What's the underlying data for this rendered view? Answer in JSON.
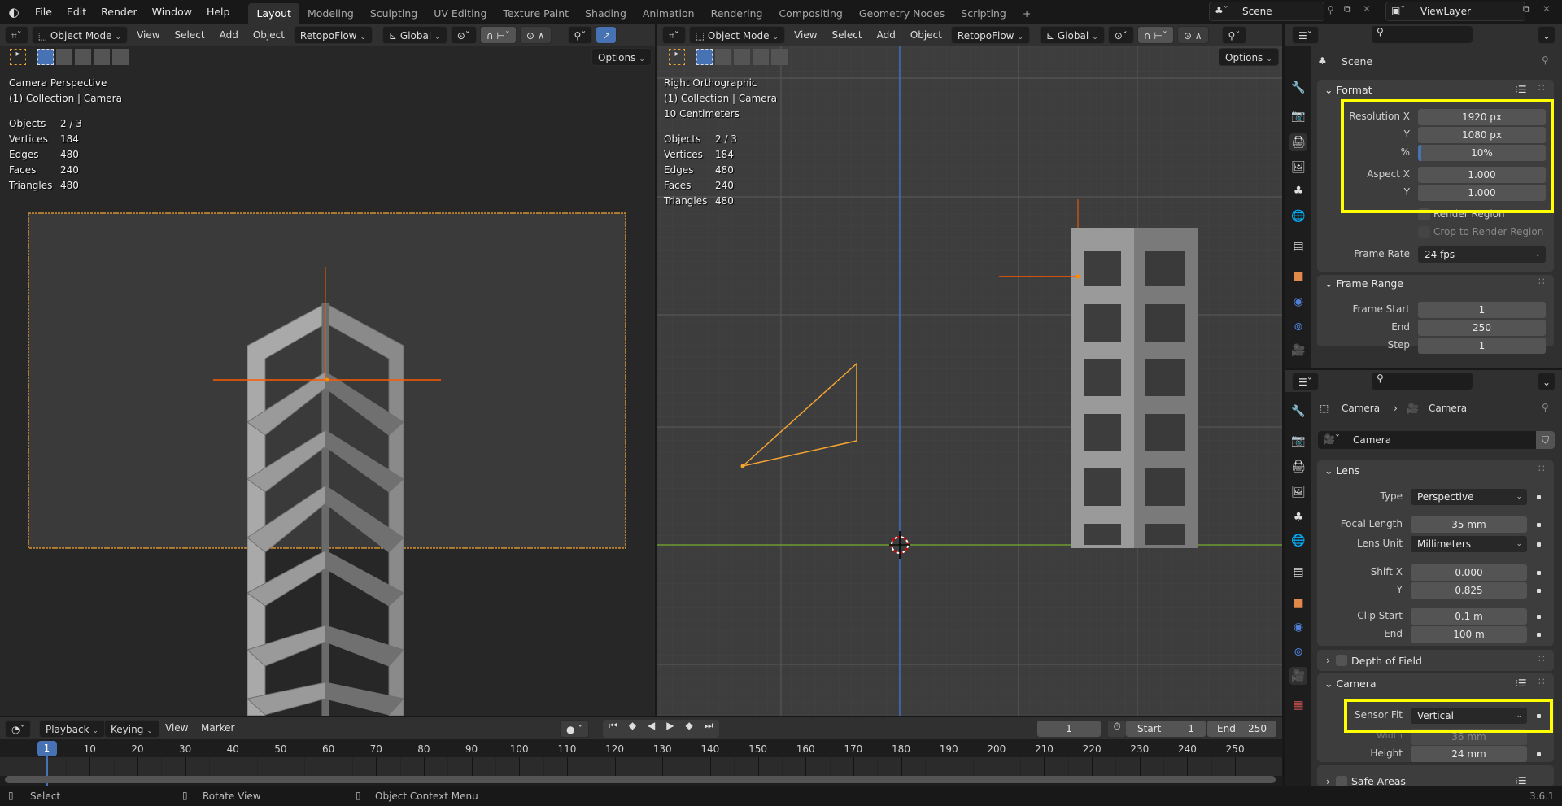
{
  "topbar": {
    "menus": [
      "File",
      "Edit",
      "Render",
      "Window",
      "Help"
    ],
    "workspaces": [
      "Layout",
      "Modeling",
      "Sculpting",
      "UV Editing",
      "Texture Paint",
      "Shading",
      "Animation",
      "Rendering",
      "Compositing",
      "Geometry Nodes",
      "Scripting"
    ],
    "active_workspace": "Layout",
    "add_tab": "+",
    "scene": "Scene",
    "view_layer": "ViewLayer"
  },
  "viewport_header": {
    "mode": "Object Mode",
    "menus": [
      "View",
      "Select",
      "Add",
      "Object"
    ],
    "addon": "RetopoFlow",
    "orientation": "Global",
    "options": "Options"
  },
  "left_viewport": {
    "title": "Camera Perspective",
    "collection": "(1) Collection | Camera",
    "stats": [
      [
        "Objects",
        "2 / 3"
      ],
      [
        "Vertices",
        "184"
      ],
      [
        "Edges",
        "480"
      ],
      [
        "Faces",
        "240"
      ],
      [
        "Triangles",
        "480"
      ]
    ]
  },
  "right_viewport": {
    "title": "Right Orthographic",
    "collection": "(1) Collection | Camera",
    "scale": "10 Centimeters",
    "stats": [
      [
        "Objects",
        "2 / 3"
      ],
      [
        "Vertices",
        "184"
      ],
      [
        "Edges",
        "480"
      ],
      [
        "Faces",
        "240"
      ],
      [
        "Triangles",
        "480"
      ]
    ]
  },
  "output_props": {
    "context": "Scene",
    "format": {
      "title": "Format",
      "resolution_x_label": "Resolution X",
      "resolution_x": "1920 px",
      "resolution_y_label": "Y",
      "resolution_y": "1080 px",
      "percent_label": "%",
      "percent": "10%",
      "percent_fill": 0.1,
      "aspect_x_label": "Aspect X",
      "aspect_x": "1.000",
      "aspect_y_label": "Y",
      "aspect_y": "1.000",
      "render_region": "Render Region",
      "crop": "Crop to Render Region",
      "frame_rate_label": "Frame Rate",
      "frame_rate": "24 fps"
    },
    "frame_range": {
      "title": "Frame Range",
      "start_label": "Frame Start",
      "start": "1",
      "end_label": "End",
      "end": "250",
      "step_label": "Step",
      "step": "1"
    }
  },
  "camera_props": {
    "breadcrumb_object": "Camera",
    "breadcrumb_data": "Camera",
    "datablock": "Camera",
    "lens": {
      "title": "Lens",
      "type_label": "Type",
      "type": "Perspective",
      "focal_label": "Focal Length",
      "focal": "35 mm",
      "unit_label": "Lens Unit",
      "unit": "Millimeters",
      "shift_x_label": "Shift X",
      "shift_x": "0.000",
      "shift_y_label": "Y",
      "shift_y": "0.825",
      "clip_start_label": "Clip Start",
      "clip_start": "0.1 m",
      "clip_end_label": "End",
      "clip_end": "100 m"
    },
    "dof": "Depth of Field",
    "camera": {
      "title": "Camera",
      "sensor_fit_label": "Sensor Fit",
      "sensor_fit": "Vertical",
      "width_label": "Width",
      "width": "36 mm",
      "height_label": "Height",
      "height": "24 mm"
    },
    "safe_areas": "Safe Areas"
  },
  "timeline": {
    "menus": [
      "Playback",
      "Keying",
      "View",
      "Marker"
    ],
    "current_frame": "1",
    "start_label": "Start",
    "start": "1",
    "end_label": "End",
    "end": "250",
    "ruler": [
      1,
      10,
      20,
      30,
      40,
      50,
      60,
      70,
      80,
      90,
      100,
      110,
      120,
      130,
      140,
      150,
      160,
      170,
      180,
      190,
      200,
      210,
      220,
      230,
      240,
      250
    ]
  },
  "statusbar": {
    "select": "Select",
    "rotate": "Rotate View",
    "context_menu": "Object Context Menu",
    "version": "3.6.1"
  },
  "colors": {
    "accent": "#4772b3",
    "highlight": "#ffff00",
    "selection": "#f5a431",
    "origin": "#ff5a00"
  }
}
